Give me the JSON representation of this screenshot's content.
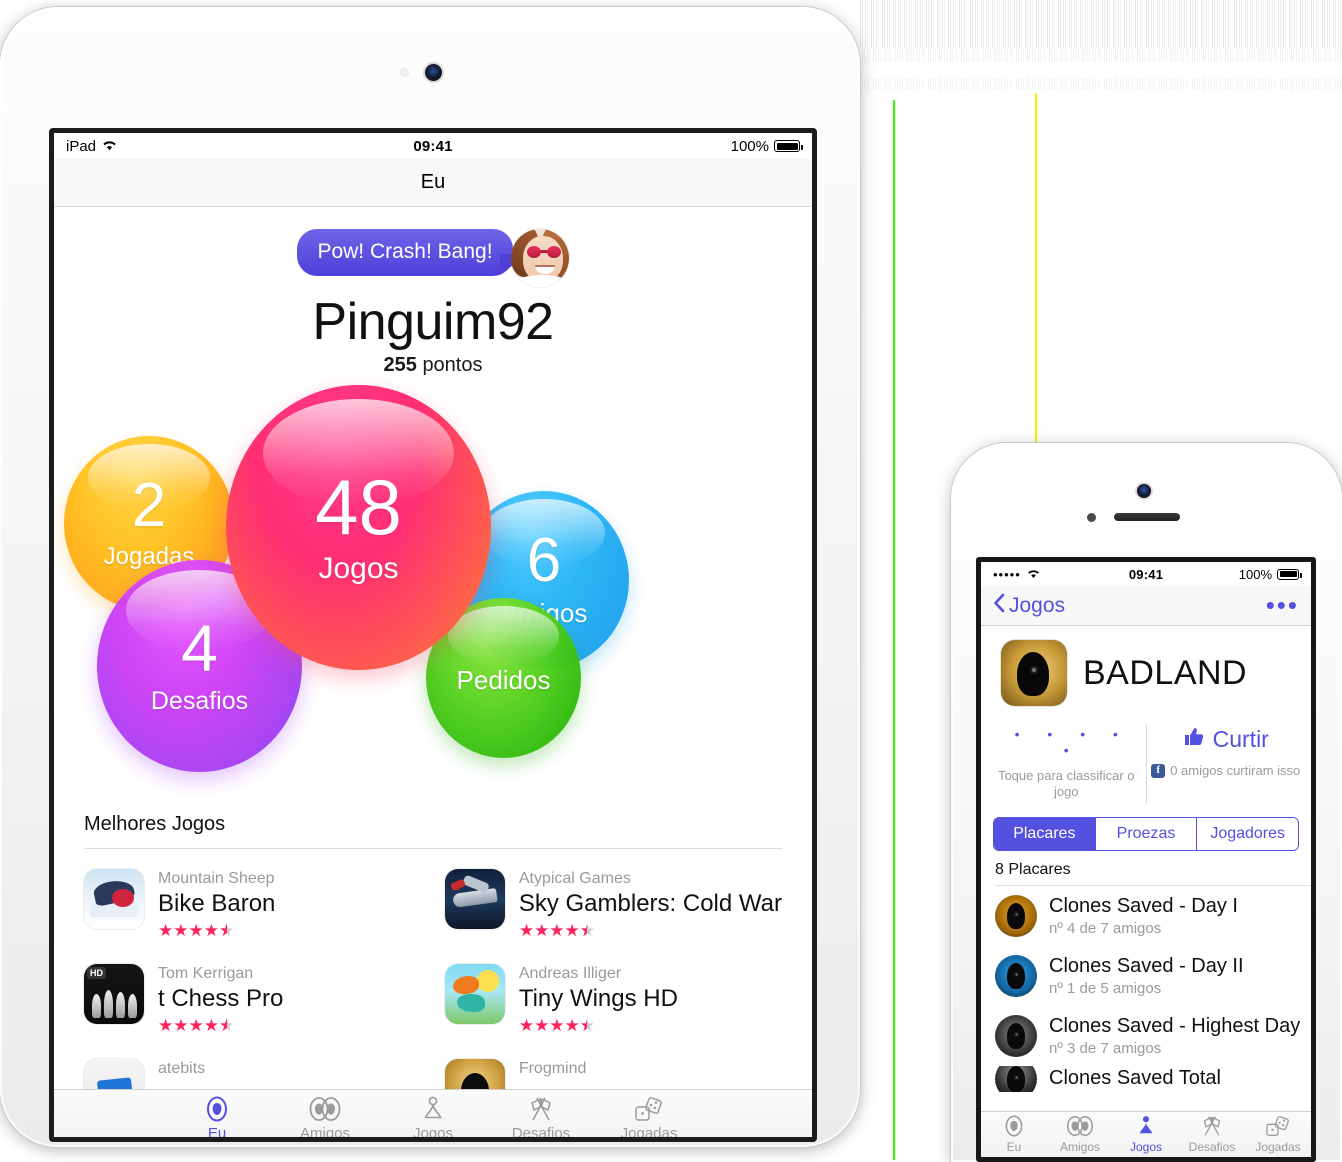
{
  "ipad": {
    "status": {
      "carrier": "iPad",
      "wifi_icon": "wifi-icon",
      "time": "09:41",
      "battery_pct": "100%"
    },
    "nav": {
      "title": "Eu"
    },
    "profile": {
      "bubble_text": "Pow! Crash! Bang!",
      "avatar_icon": "avatar",
      "username": "Pinguim92",
      "points_value": "255",
      "points_label": "pontos"
    },
    "orbs": [
      {
        "key": "jogadas",
        "number": "2",
        "label": "Jogadas",
        "color": "#FFB81C"
      },
      {
        "key": "jogos",
        "number": "48",
        "label": "Jogos",
        "color": "#FF2E74"
      },
      {
        "key": "desafios",
        "number": "4",
        "label": "Desafios",
        "color": "#B43EF4"
      },
      {
        "key": "amigos",
        "number": "6",
        "label": "Amigos",
        "color": "#1FAEEF"
      },
      {
        "key": "pedidos",
        "number": "",
        "label": "Pedidos",
        "color": "#3FC410"
      }
    ],
    "section": {
      "title": "Melhores Jogos"
    },
    "games": [
      {
        "developer": "Mountain Sheep",
        "name": "Bike Baron",
        "rating": "4.5",
        "icon": "bike-baron-icon"
      },
      {
        "developer": "Atypical Games",
        "name": "Sky Gamblers: Cold War",
        "rating": "4.5",
        "icon": "sky-gamblers-icon"
      },
      {
        "developer": "Tom Kerrigan",
        "name": "t Chess Pro",
        "rating": "4.5",
        "icon": "t-chess-pro-icon"
      },
      {
        "developer": "Andreas Illiger",
        "name": "Tiny Wings HD",
        "rating": "4.5",
        "icon": "tiny-wings-icon"
      },
      {
        "developer": "atebits",
        "name": "",
        "rating": "",
        "icon": "atebits-icon"
      },
      {
        "developer": "Frogmind",
        "name": "",
        "rating": "",
        "icon": "frogmind-icon"
      }
    ],
    "tabs": [
      {
        "label": "Eu",
        "icon": "person-icon",
        "active": true
      },
      {
        "label": "Amigos",
        "icon": "friends-icon",
        "active": false
      },
      {
        "label": "Jogos",
        "icon": "pawn-icon",
        "active": false
      },
      {
        "label": "Desafios",
        "icon": "flags-icon",
        "active": false
      },
      {
        "label": "Jogadas",
        "icon": "dice-icon",
        "active": false
      }
    ]
  },
  "iphone": {
    "status": {
      "signal_dots": "•••••",
      "wifi_icon": "wifi-icon",
      "time": "09:41",
      "battery_pct": "100%"
    },
    "nav": {
      "back_label": "Jogos",
      "back_icon": "chevron-left-icon",
      "more_icon": "ellipsis-icon"
    },
    "game": {
      "title": "BADLAND",
      "icon": "badland-icon"
    },
    "rating": {
      "dots": "• • • • •",
      "caption": "Toque para classificar o jogo",
      "like_label": "Curtir",
      "like_icon": "thumbs-up-icon",
      "fb_icon": "facebook-icon",
      "fb_caption": "0 amigos curtiram isso"
    },
    "segments": [
      {
        "label": "Placares",
        "selected": true
      },
      {
        "label": "Proezas",
        "selected": false
      },
      {
        "label": "Jogadores",
        "selected": false
      }
    ],
    "leaderboards_count": "8 Placares",
    "leaderboards": [
      {
        "name": "Clones Saved - Day I",
        "sub": "nº 4 de 7 amigos",
        "icon": "badland-amber-icon"
      },
      {
        "name": "Clones Saved - Day II",
        "sub": "nº 1 de 5 amigos",
        "icon": "badland-blue-icon"
      },
      {
        "name": "Clones Saved - Highest Day",
        "sub": "nº 3 de 7 amigos",
        "icon": "badland-dark-icon"
      },
      {
        "name": "Clones Saved Total",
        "sub": "",
        "icon": "badland-dark2-icon"
      }
    ],
    "tabs": [
      {
        "label": "Eu",
        "icon": "person-icon",
        "active": false
      },
      {
        "label": "Amigos",
        "icon": "friends-icon",
        "active": false
      },
      {
        "label": "Jogos",
        "icon": "pawn-icon",
        "active": true
      },
      {
        "label": "Desafios",
        "icon": "flags-icon",
        "active": false
      },
      {
        "label": "Jogadas",
        "icon": "dice-icon",
        "active": false
      }
    ]
  },
  "theme": {
    "accent": "#5450E0",
    "star": "#FF245E",
    "muted": "#9B9B9B"
  }
}
